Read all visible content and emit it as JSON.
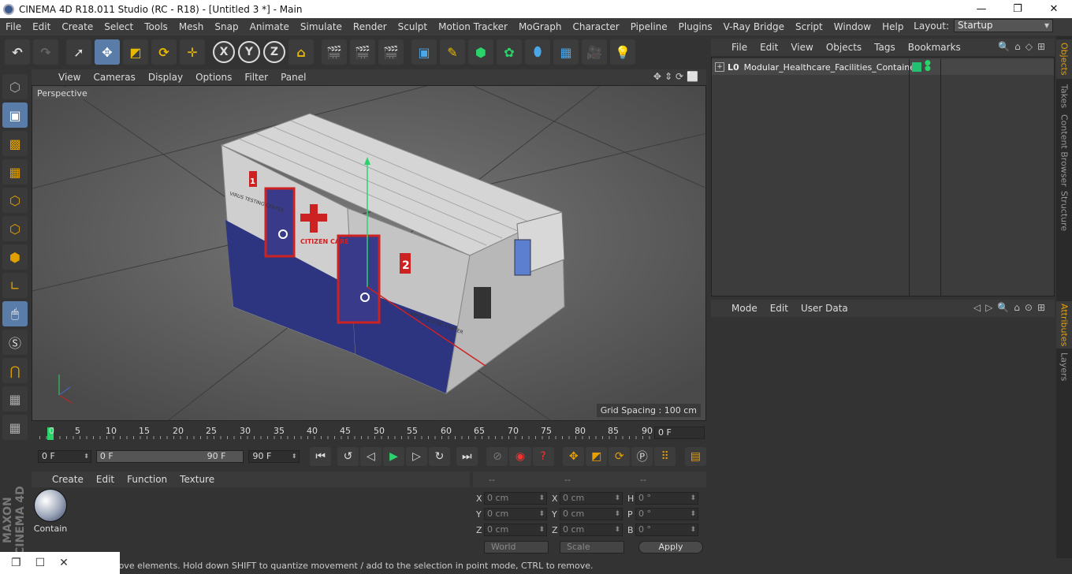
{
  "window": {
    "title": "CINEMA 4D R18.011 Studio (RC - R18) - [Untitled 3 *] - Main",
    "btn_min": "—",
    "btn_max": "❐",
    "btn_close": "✕"
  },
  "menu": [
    "File",
    "Edit",
    "Create",
    "Select",
    "Tools",
    "Mesh",
    "Snap",
    "Animate",
    "Simulate",
    "Render",
    "Sculpt",
    "Motion Tracker",
    "MoGraph",
    "Character",
    "Pipeline",
    "Plugins",
    "V-Ray Bridge",
    "Script",
    "Window",
    "Help"
  ],
  "layout": {
    "label": "Layout:",
    "value": "Startup"
  },
  "toolbar": {
    "x": "X",
    "y": "Y",
    "z": "Z"
  },
  "viewport": {
    "menu": [
      "View",
      "Cameras",
      "Display",
      "Options",
      "Filter",
      "Panel"
    ],
    "label": "Perspective",
    "grid_spacing": "Grid Spacing : 100 cm",
    "container_text_left": "VIRUS TESTING CENTER",
    "container_text_right": "VIRUS TESTING CENTER",
    "container_text_mid": "CITIZEN CARE",
    "badge": "2",
    "badge2": "1"
  },
  "timeline": {
    "ticks": [
      "0",
      "5",
      "10",
      "15",
      "20",
      "25",
      "30",
      "35",
      "40",
      "45",
      "50",
      "55",
      "60",
      "65",
      "70",
      "75",
      "80",
      "85",
      "90"
    ],
    "frame": "0 F"
  },
  "transport": {
    "start": "0 F",
    "range_start": "0 F",
    "range_end": "90 F",
    "end": "90 F"
  },
  "materials": {
    "menu": [
      "Create",
      "Edit",
      "Function",
      "Texture"
    ],
    "item": "Contain"
  },
  "coords": {
    "headers": [
      "--",
      "--",
      "--"
    ],
    "rows": [
      {
        "a1": "X",
        "v1": "0 cm",
        "a2": "X",
        "v2": "0 cm",
        "a3": "H",
        "v3": "0 °"
      },
      {
        "a1": "Y",
        "v1": "0 cm",
        "a2": "Y",
        "v2": "0 cm",
        "a3": "P",
        "v3": "0 °"
      },
      {
        "a1": "Z",
        "v1": "0 cm",
        "a2": "Z",
        "v2": "0 cm",
        "a3": "B",
        "v3": "0 °"
      }
    ],
    "world": "World",
    "scale": "Scale",
    "apply": "Apply"
  },
  "objects": {
    "menu": [
      "File",
      "Edit",
      "View",
      "Objects",
      "Tags",
      "Bookmarks"
    ],
    "item": "Modular_Healthcare_Facilities_Container",
    "lo": "L0"
  },
  "attributes": {
    "menu": [
      "Mode",
      "Edit",
      "User Data"
    ]
  },
  "side_tabs": [
    "Objects",
    "Takes",
    "Content Browser",
    "Structure",
    "Attributes",
    "Layers"
  ],
  "status": "Move: Click and drag to move elements. Hold down SHIFT to quantize movement / add to the selection in point mode, CTRL to remove.",
  "maxon": "MAXON CINEMA 4D"
}
